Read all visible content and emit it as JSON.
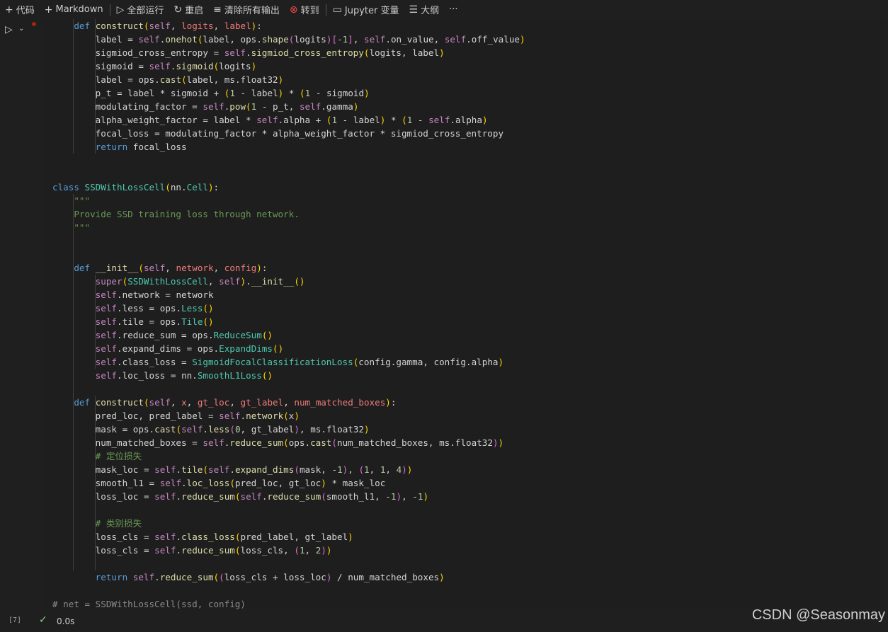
{
  "toolbar": {
    "code_label": "代码",
    "markdown_label": "Markdown",
    "run_all_label": "全部运行",
    "restart_label": "重启",
    "clear_outputs_label": "清除所有输出",
    "goto_label": "转到",
    "variables_label": "Jupyter 变量",
    "outline_label": "大纲",
    "more_label": "···"
  },
  "cell": {
    "exec_count": "[7]",
    "duration": "0.0s"
  },
  "code_lines": [
    "    def construct(self, logits, label):",
    "        label = self.onehot(label, ops.shape(logits)[-1], self.on_value, self.off_value)",
    "        sigmiod_cross_entropy = self.sigmiod_cross_entropy(logits, label)",
    "        sigmoid = self.sigmoid(logits)",
    "        label = ops.cast(label, ms.float32)",
    "        p_t = label * sigmoid + (1 - label) * (1 - sigmoid)",
    "        modulating_factor = self.pow(1 - p_t, self.gamma)",
    "        alpha_weight_factor = label * self.alpha + (1 - label) * (1 - self.alpha)",
    "        focal_loss = modulating_factor * alpha_weight_factor * sigmiod_cross_entropy",
    "        return focal_loss",
    "",
    "",
    "class SSDWithLossCell(nn.Cell):",
    "    \"\"\"",
    "    Provide SSD training loss through network.",
    "    \"\"\"",
    "",
    "",
    "    def __init__(self, network, config):",
    "        super(SSDWithLossCell, self).__init__()",
    "        self.network = network",
    "        self.less = ops.Less()",
    "        self.tile = ops.Tile()",
    "        self.reduce_sum = ops.ReduceSum()",
    "        self.expand_dims = ops.ExpandDims()",
    "        self.class_loss = SigmoidFocalClassificationLoss(config.gamma, config.alpha)",
    "        self.loc_loss = nn.SmoothL1Loss()",
    "",
    "    def construct(self, x, gt_loc, gt_label, num_matched_boxes):",
    "        pred_loc, pred_label = self.network(x)",
    "        mask = ops.cast(self.less(0, gt_label), ms.float32)",
    "        num_matched_boxes = self.reduce_sum(ops.cast(num_matched_boxes, ms.float32))",
    "        # 定位损失",
    "        mask_loc = self.tile(self.expand_dims(mask, -1), (1, 1, 4))",
    "        smooth_l1 = self.loc_loss(pred_loc, gt_loc) * mask_loc",
    "        loss_loc = self.reduce_sum(self.reduce_sum(smooth_l1, -1), -1)",
    "",
    "        # 类别损失",
    "        loss_cls = self.class_loss(pred_label, gt_label)",
    "        loss_cls = self.reduce_sum(loss_cls, (1, 2))",
    "",
    "        return self.reduce_sum((loss_cls + loss_loc) / num_matched_boxes)",
    "",
    "# net = SSDWithLossCell(ssd, config)"
  ],
  "watermark": "CSDN @Seasonmay",
  "colors": {
    "keyword": "#569cd6",
    "function": "#dcdcaa",
    "class": "#4ec9b0",
    "self": "#c586c0",
    "param": "#ef7b7b",
    "number": "#b5cea8",
    "comment": "#6a9955",
    "success": "#89d185"
  }
}
